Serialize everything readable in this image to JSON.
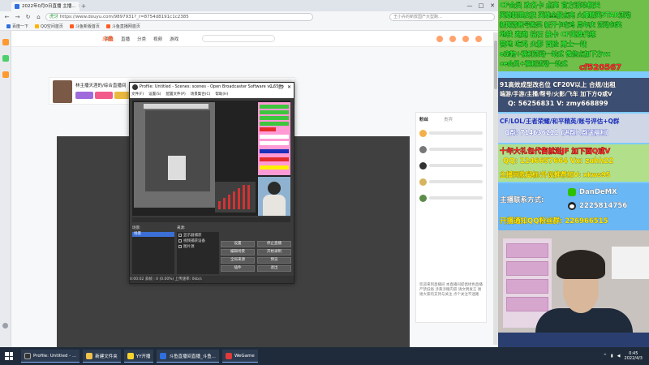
{
  "browser": {
    "tab_title": "2022年0月0日直播 主播...",
    "url_prefix": "虎牙",
    "url": "https://www.douyu.com/9897931?_r=8754d8191c1c2385",
    "search_placeholder": "王小卉的新款国产大型跑...",
    "bookmarks": [
      "百度一下",
      "QQ空间首页",
      "斗鱼新版首页",
      "斗鱼直播网首页"
    ],
    "win_controls": [
      "—",
      "□",
      "✕"
    ]
  },
  "site": {
    "logo": "斗鱼",
    "nav": [
      "首页",
      "直播",
      "分类",
      "视频",
      "游戏"
    ],
    "room_title": "林主播天涯的/综合直播间",
    "side_tab_active": "粉丝",
    "side_tab_other": "贵宾",
    "side_notice": "欢迎来到直播间 本直播间提倡绿色直播 严禁低俗 涉黄涉赌内容 请文明发言 谢谢大家的支持与关注 点个关注不迷路"
  },
  "obs": {
    "title": "Profile: Untitled - Scenes: scenes - Open Broadcaster Software v0.659b",
    "menu": [
      "文件(F)",
      "设置(S)",
      "配置文件(P)",
      "场景集合(C)",
      "帮助(H)"
    ],
    "scenes_label": "场景:",
    "sources_label": "来源:",
    "scene_selected": "场景",
    "sources": [
      "显示器捕获",
      "视频捕获设备",
      "图片源"
    ],
    "buttons": {
      "settings": "设置",
      "stop_stream": "停止直播",
      "edit_scene": "编辑场景",
      "start_record": "开始录制",
      "global_sources": "全局来源",
      "preview": "预览",
      "plugins": "插件",
      "exit": "退出"
    },
    "status": "0:00:02  丢帧 : 0 (0.00%)        上传速率: 0kb/s"
  },
  "overlay": {
    "lines": [
      {
        "text": "CF会员 改名卡 点亮 官方活动相关",
        "cls": "gr"
      },
      {
        "text": "英雄联盟皮肤 英雄全服点亮 火爆精英STAR活动",
        "cls": "gr"
      },
      {
        "text": "新网游账号购买 新开卡吃鸡 周年庆 活动包奖",
        "cls": "gr"
      },
      {
        "text": "地铁 跑跑 钻石 抽卡 CF英雄代练",
        "cls": "gr"
      },
      {
        "text": "营地 吃鸡 火影 冒险 勇士一站",
        "cls": "gr"
      },
      {
        "text": "e宠物+福利活动一站式 微信点加下方vx",
        "cls": "gr"
      },
      {
        "text": "ce会员+福利活动一站式",
        "cls": "gr"
      },
      {
        "text": "cf520567",
        "cls": "rd"
      },
      {
        "text": "91高效成型改名位 CF20V以上  合规/出租",
        "cls": "wh"
      },
      {
        "text": "端游/手游/主播/帮号/火影/飞车 加下方Q或V",
        "cls": "wh"
      },
      {
        "text": "Q: 56256831 V: zmy668899",
        "cls": "wh"
      },
      {
        "text": "CF/LOL/王者荣耀/和平精英/账号评估+Q群",
        "cls": "bl"
      },
      {
        "text": "Q群: 714636211 (进群入群送福利)",
        "cls": "wh"
      },
      {
        "text": "十年大礼包代售就送JF 加下面Q或V",
        "cls": "rd"
      },
      {
        "text": "QQ: 1246657664 Vx: zuhh22",
        "cls": "ye"
      },
      {
        "text": "主播同款鼠标/外设推荐加V: xkws95",
        "cls": "ye"
      },
      {
        "text": "主播联系方式:",
        "cls": "wh"
      },
      {
        "text": "DanDeMX",
        "cls": "wh"
      },
      {
        "text": "2225814756",
        "cls": "wh"
      },
      {
        "text": "开播通知QQ粉丝群: 226966515",
        "cls": "ye"
      }
    ]
  },
  "taskbar": {
    "items": [
      "Profile: Untitled - ...",
      "新建文件夹",
      "YY开播",
      "斗鱼直播间直播_斗鱼...",
      "WeGame"
    ],
    "time": "0:45",
    "date": "2022/4/3"
  },
  "colors": {
    "overlay_bg": "#7ecbff",
    "obs_dark": "#3b3b3b",
    "taskbar": "#1f2b3a",
    "accent_orange": "#ff5d23"
  }
}
